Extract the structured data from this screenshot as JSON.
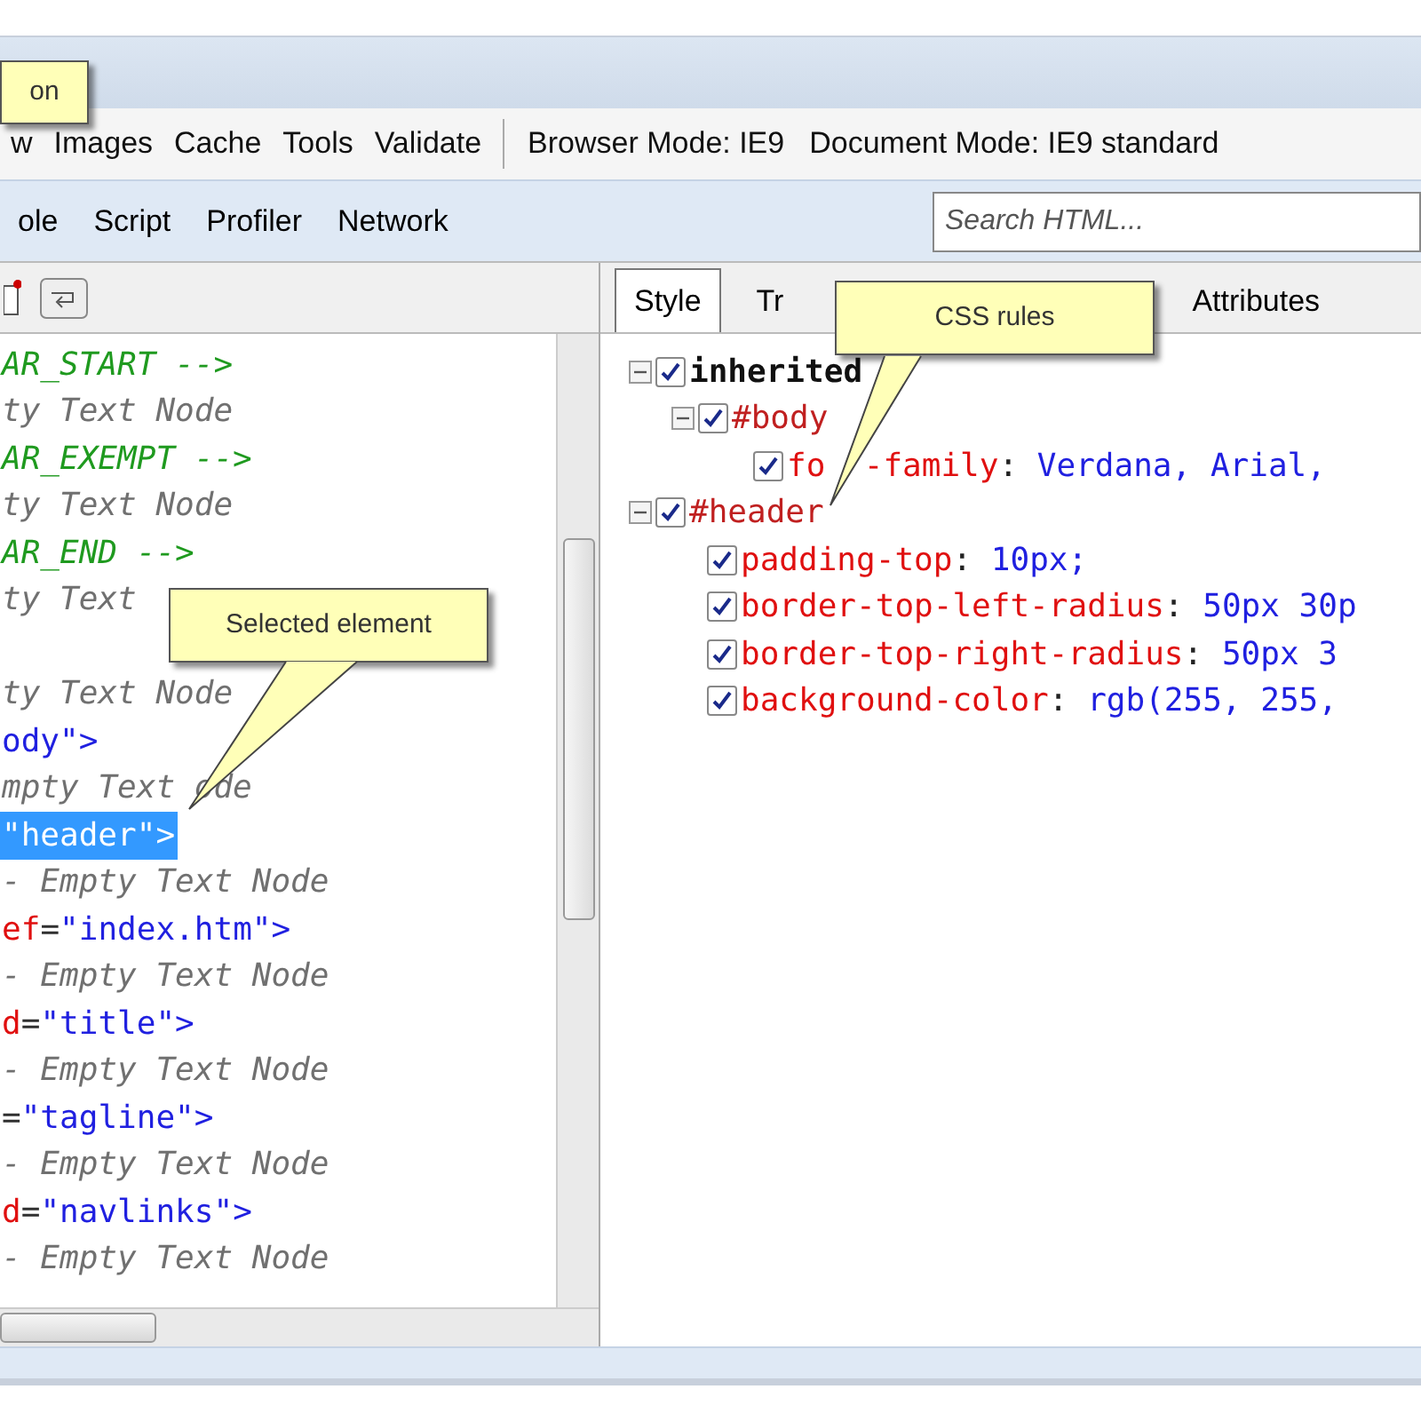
{
  "menu": {
    "items": [
      "w",
      "Images",
      "Cache",
      "Tools",
      "Validate"
    ],
    "modes": [
      "Browser Mode: IE9",
      "Document Mode: IE9 standard"
    ]
  },
  "tabs": [
    {
      "label": "ole",
      "selected": false
    },
    {
      "label": "Script",
      "selected": false
    },
    {
      "label": "Profiler",
      "selected": false
    },
    {
      "label": "Network",
      "selected": false
    }
  ],
  "search": {
    "placeholder": "Search HTML..."
  },
  "dom_lines": [
    {
      "selected": false,
      "segments": [
        {
          "kind": "comment",
          "text": "AR_START -->"
        }
      ]
    },
    {
      "selected": false,
      "segments": [
        {
          "kind": "textnode",
          "text": "ty Text Node"
        }
      ]
    },
    {
      "selected": false,
      "segments": [
        {
          "kind": "comment",
          "text": "AR_EXEMPT -->"
        }
      ]
    },
    {
      "selected": false,
      "segments": [
        {
          "kind": "textnode",
          "text": "ty Text Node"
        }
      ]
    },
    {
      "selected": false,
      "segments": [
        {
          "kind": "comment",
          "text": "AR_END -->"
        }
      ]
    },
    {
      "selected": false,
      "segments": [
        {
          "kind": "textnode",
          "text": "ty Text"
        }
      ]
    },
    {
      "selected": false,
      "segments": [
        {
          "kind": "textnode",
          "text": "ty Text Node"
        }
      ]
    },
    {
      "selected": false,
      "segments": [
        {
          "kind": "value",
          "text": "ody\""
        },
        {
          "kind": "tag",
          "text": ">"
        }
      ]
    },
    {
      "selected": false,
      "segments": [
        {
          "kind": "textnode",
          "text": "mpty Text ode"
        }
      ]
    },
    {
      "selected": true,
      "segments": [
        {
          "kind": "value",
          "text": "\"header\""
        },
        {
          "kind": "tag",
          "text": ">"
        }
      ]
    },
    {
      "selected": false,
      "segments": [
        {
          "kind": "textnode",
          "text": "- Empty Text Node"
        }
      ]
    },
    {
      "selected": false,
      "segments": [
        {
          "kind": "attr",
          "text": "ef"
        },
        {
          "kind": "punct",
          "text": "="
        },
        {
          "kind": "value",
          "text": "\"index.htm\""
        },
        {
          "kind": "tag",
          "text": ">"
        }
      ]
    },
    {
      "selected": false,
      "segments": [
        {
          "kind": "textnode",
          "text": "- Empty Text Node"
        }
      ]
    },
    {
      "selected": false,
      "segments": [
        {
          "kind": "attr",
          "text": "d"
        },
        {
          "kind": "punct",
          "text": "="
        },
        {
          "kind": "value",
          "text": "\"title\""
        },
        {
          "kind": "tag",
          "text": ">"
        }
      ]
    },
    {
      "selected": false,
      "segments": [
        {
          "kind": "textnode",
          "text": "- Empty Text Node"
        }
      ]
    },
    {
      "selected": false,
      "segments": [
        {
          "kind": "punct",
          "text": "="
        },
        {
          "kind": "value",
          "text": "\"tagline\""
        },
        {
          "kind": "tag",
          "text": ">"
        }
      ]
    },
    {
      "selected": false,
      "segments": [
        {
          "kind": "textnode",
          "text": "- Empty Text Node"
        }
      ]
    },
    {
      "selected": false,
      "segments": [
        {
          "kind": "attr",
          "text": "d"
        },
        {
          "kind": "punct",
          "text": "="
        },
        {
          "kind": "value",
          "text": "\"navlinks\""
        },
        {
          "kind": "tag",
          "text": ">"
        }
      ]
    },
    {
      "selected": false,
      "segments": [
        {
          "kind": "textnode",
          "text": "- Empty Text Node"
        }
      ]
    }
  ],
  "style_tabs": [
    {
      "label": "Style",
      "selected": true
    },
    {
      "label": "Tr",
      "selected": false
    },
    {
      "label": "Attributes",
      "selected": false
    }
  ],
  "rules": [
    {
      "kind": "group",
      "label": "inherited",
      "checked": true,
      "expanded": true,
      "children": [
        {
          "kind": "selector",
          "label": "#body",
          "checked": true,
          "expanded": true,
          "children": [
            {
              "kind": "property",
              "name": "fo",
              "name_continued": "-family",
              "separator": ":",
              "value": "Verdana, Arial,",
              "checked": true
            }
          ]
        }
      ]
    },
    {
      "kind": "selector",
      "label": "#header",
      "checked": true,
      "expanded": true,
      "children": [
        {
          "kind": "property",
          "name": "padding-top",
          "separator": ":",
          "value": "10px;",
          "checked": true
        },
        {
          "kind": "property",
          "name": "border-top-left-radius",
          "separator": ":",
          "value": "50px 30p",
          "checked": true
        },
        {
          "kind": "property",
          "name": "border-top-right-radius",
          "separator": ":",
          "value": "50px 3",
          "checked": true
        },
        {
          "kind": "property",
          "name": "background-color",
          "separator": ":",
          "value": "rgb(255, 255,",
          "checked": true
        }
      ]
    }
  ],
  "callouts": [
    {
      "kind": "top",
      "text": "on"
    },
    {
      "kind": "dom",
      "text": "Selected element"
    },
    {
      "kind": "css",
      "text": "CSS rules"
    }
  ]
}
